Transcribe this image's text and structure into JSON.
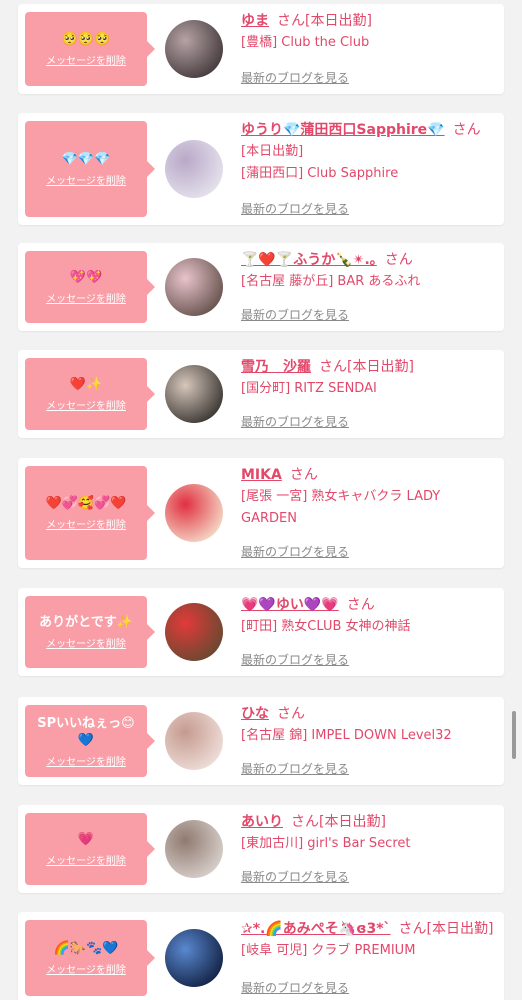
{
  "ui": {
    "delete_label": "メッセージを削除",
    "blog_label": "最新のブログを見る",
    "honorific": "さん",
    "accent_color": "#f99da7",
    "text_color": "#e2486a"
  },
  "cards": [
    {
      "message": "🥺🥺🥺",
      "name": "ゆま",
      "status": "[本日出勤]",
      "shop": "[豊橋] Club the Club",
      "avatar_colors": [
        "#3c3236",
        "#b6a3a4"
      ]
    },
    {
      "message": "💎💎💎",
      "name": "ゆうり💎蒲田西口Sapphire💎",
      "status": "",
      "status_line": "[本日出勤]",
      "shop": "[蒲田西口] Club Sapphire",
      "avatar_colors": [
        "#e8e6ef",
        "#b9a8c8"
      ]
    },
    {
      "message": "💖💖",
      "name": "🍸❤️🍸ふうか🍾✴︎.｡",
      "status": "",
      "shop": "[名古屋 藤が丘] BAR あるふれ",
      "avatar_colors": [
        "#5e4a44",
        "#e7c4cb"
      ]
    },
    {
      "message": "❤️✨",
      "name": "雪乃　沙羅",
      "status": "[本日出勤]",
      "shop": "[国分町] RITZ SENDAI",
      "avatar_colors": [
        "#2f2b28",
        "#d6c7bb"
      ]
    },
    {
      "message": "❤️💞🥰💞❤️",
      "name": "MIKA",
      "status": "",
      "shop": "[尾張 一宮] 熟女キャバクラ LADY GARDEN",
      "avatar_colors": [
        "#f6e5d0",
        "#e03040"
      ]
    },
    {
      "message": "ありがとです✨",
      "name": "💗💜ゆい💜💗",
      "status": "",
      "shop": "[町田] 熟女CLUB 女神の神話",
      "avatar_colors": [
        "#5f4a30",
        "#e23a3a"
      ]
    },
    {
      "message": "SPいいねぇっ😊💙",
      "name": "ひな",
      "status": "",
      "shop": "[名古屋 錦] IMPEL DOWN Level32",
      "avatar_colors": [
        "#f1e3de",
        "#c59a8f"
      ]
    },
    {
      "message": "💗",
      "name": "あいり",
      "status": "[本日出勤]",
      "shop": "[東加古川] girl's Bar Secret",
      "avatar_colors": [
        "#ded6d2",
        "#8f7a70"
      ]
    },
    {
      "message": "🌈🐎🐾💙",
      "name": "✰*.🌈あみぺそ🦄ɞ3*ˋ",
      "status": "[本日出勤]",
      "shop": "[岐阜 可児] クラブ PREMIUM",
      "avatar_colors": [
        "#0d1b3a",
        "#5a88d0"
      ]
    }
  ]
}
